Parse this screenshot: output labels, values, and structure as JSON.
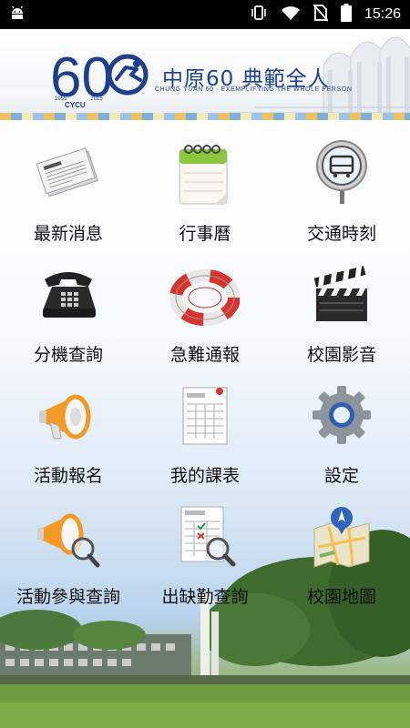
{
  "status_bar": {
    "time": "15:26",
    "icons": [
      "android-icon",
      "vibrate-icon",
      "wifi-icon",
      "no-sim-icon",
      "battery-icon"
    ]
  },
  "banner": {
    "title": "中原60 典範全人",
    "subtitle": "CHUNG YUAN 60 · EXEMPLIFYING THE WHOLE PERSON",
    "logo_number": "60",
    "year_start": "1955",
    "year_end": "2015",
    "logo_text": "CYCU",
    "brand_color": "#1d3f8c"
  },
  "menu": [
    {
      "label": "最新消息",
      "icon": "newspaper-icon"
    },
    {
      "label": "行事曆",
      "icon": "calendar-icon"
    },
    {
      "label": "交通時刻",
      "icon": "bus-map-pin-icon"
    },
    {
      "label": "分機查詢",
      "icon": "telephone-icon"
    },
    {
      "label": "急難通報",
      "icon": "lifebuoy-icon"
    },
    {
      "label": "校園影音",
      "icon": "clapperboard-icon"
    },
    {
      "label": "活動報名",
      "icon": "megaphone-icon"
    },
    {
      "label": "我的課表",
      "icon": "timetable-icon"
    },
    {
      "label": "設定",
      "icon": "gear-icon"
    },
    {
      "label": "活動參與查詢",
      "icon": "megaphone-search-icon"
    },
    {
      "label": "出缺勤查詢",
      "icon": "attendance-search-icon"
    },
    {
      "label": "校園地圖",
      "icon": "map-icon"
    }
  ]
}
